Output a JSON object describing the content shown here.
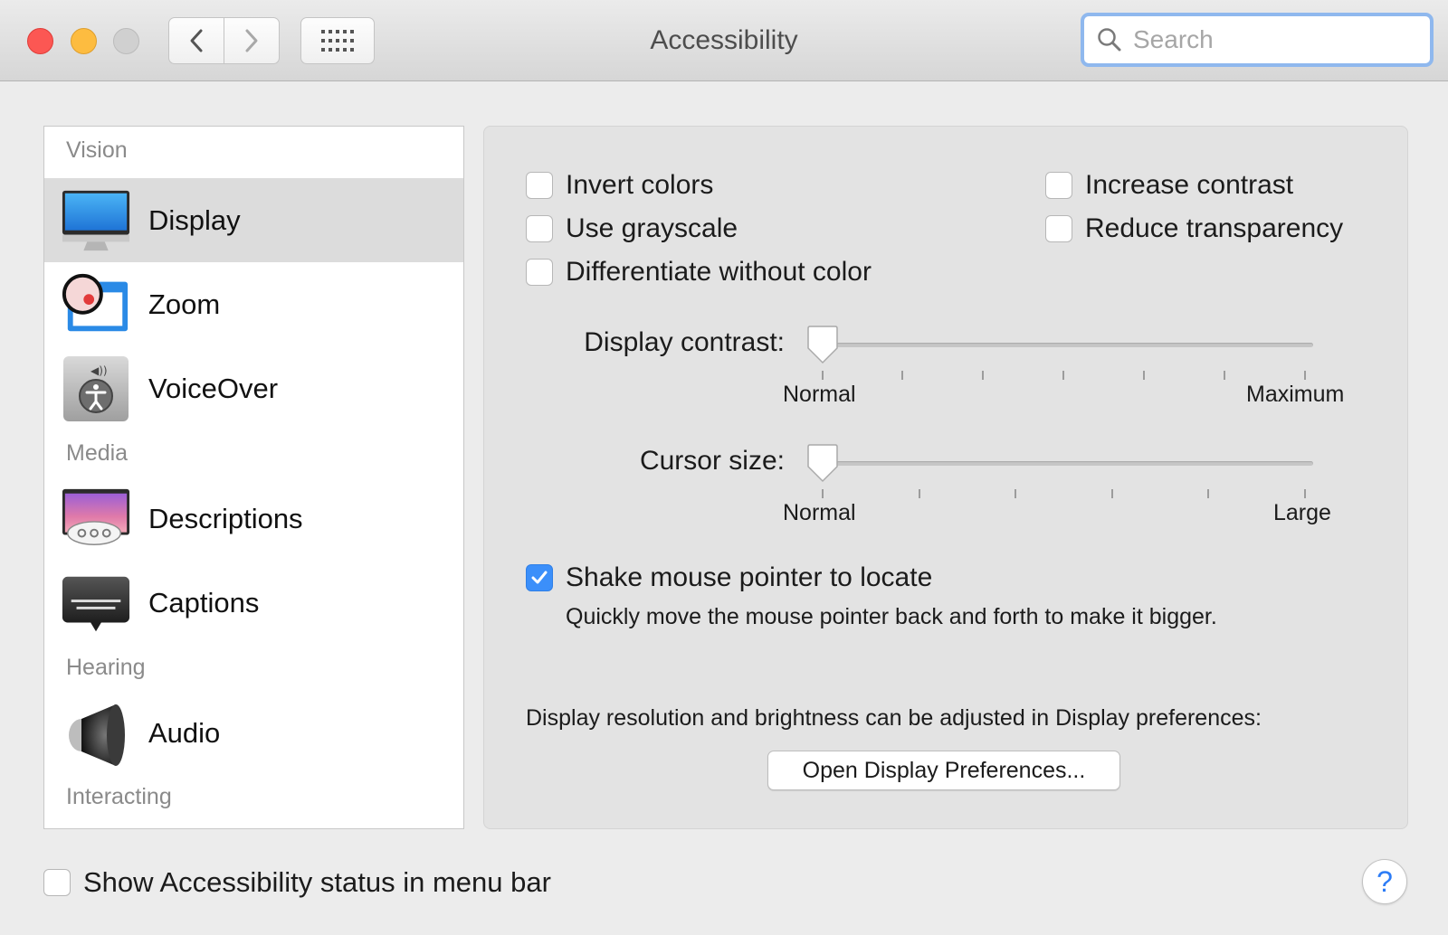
{
  "window": {
    "title": "Accessibility",
    "search_placeholder": "Search"
  },
  "sidebar": {
    "sections": [
      {
        "header": "Vision"
      },
      {
        "header": "Media"
      },
      {
        "header": "Hearing"
      },
      {
        "header": "Interacting"
      }
    ],
    "items": [
      {
        "label": "Display",
        "icon": "display-icon",
        "selected": true
      },
      {
        "label": "Zoom",
        "icon": "zoom-icon"
      },
      {
        "label": "VoiceOver",
        "icon": "voiceover-icon"
      },
      {
        "label": "Descriptions",
        "icon": "descriptions-icon"
      },
      {
        "label": "Captions",
        "icon": "captions-icon"
      },
      {
        "label": "Audio",
        "icon": "speaker-icon"
      }
    ]
  },
  "display": {
    "invert_colors": {
      "label": "Invert colors",
      "checked": false
    },
    "use_grayscale": {
      "label": "Use grayscale",
      "checked": false
    },
    "differentiate": {
      "label": "Differentiate without color",
      "checked": false
    },
    "increase_contrast": {
      "label": "Increase contrast",
      "checked": false
    },
    "reduce_transparency": {
      "label": "Reduce transparency",
      "checked": false
    },
    "contrast_slider": {
      "label": "Display contrast:",
      "min_label": "Normal",
      "max_label": "Maximum",
      "value": 0
    },
    "cursor_slider": {
      "label": "Cursor size:",
      "min_label": "Normal",
      "max_label": "Large",
      "value": 0
    },
    "shake": {
      "label": "Shake mouse pointer to locate",
      "checked": true,
      "description": "Quickly move the mouse pointer back and forth to make it bigger."
    },
    "resolution_note": "Display resolution and brightness can be adjusted in Display preferences:",
    "open_button": "Open Display Preferences..."
  },
  "footer": {
    "status_checkbox": {
      "label": "Show Accessibility status in menu bar",
      "checked": false
    },
    "help": "?"
  },
  "colors": {
    "accent": "#3b8ffa",
    "close": "#fc5753",
    "minimize": "#fdbc40"
  }
}
